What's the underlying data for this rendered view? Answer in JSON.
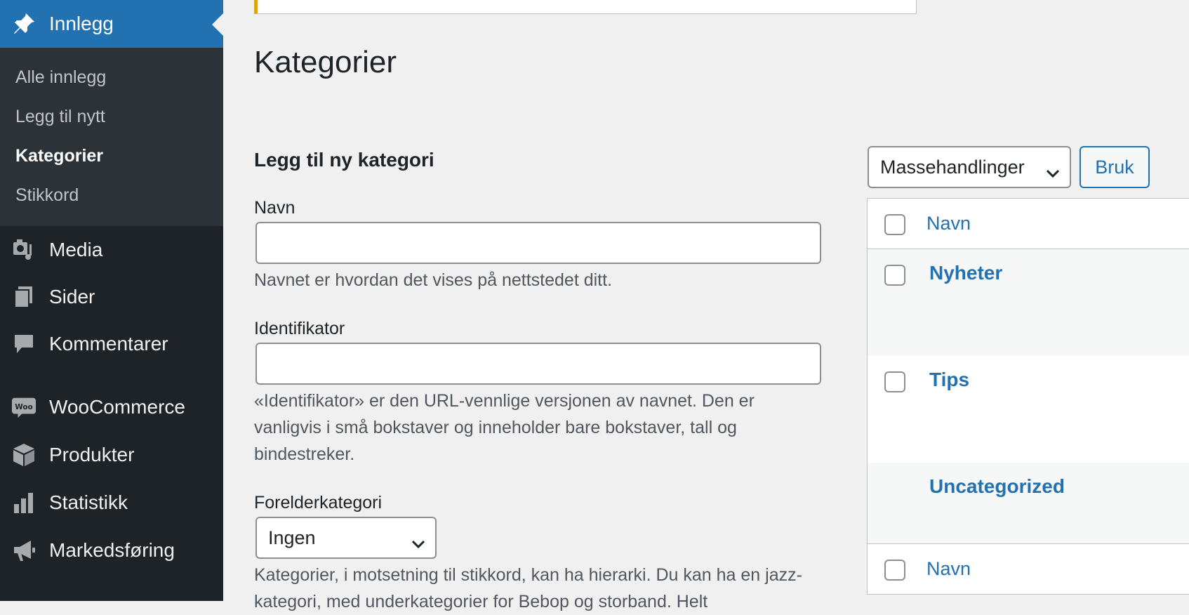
{
  "sidebar": {
    "active_menu": {
      "label": "Innlegg",
      "icon": "pin-icon"
    },
    "submenu": [
      {
        "label": "Alle innlegg",
        "current": false
      },
      {
        "label": "Legg til nytt",
        "current": false
      },
      {
        "label": "Kategorier",
        "current": true
      },
      {
        "label": "Stikkord",
        "current": false
      }
    ],
    "menu": [
      {
        "label": "Media",
        "icon": "media-icon"
      },
      {
        "label": "Sider",
        "icon": "pages-icon"
      },
      {
        "label": "Kommentarer",
        "icon": "comment-icon"
      },
      {
        "label": "WooCommerce",
        "icon": "woocommerce-icon",
        "icon_text": "Woo"
      },
      {
        "label": "Produkter",
        "icon": "box-icon"
      },
      {
        "label": "Statistikk",
        "icon": "bar-chart-icon"
      },
      {
        "label": "Markedsføring",
        "icon": "megaphone-icon"
      }
    ],
    "colors": {
      "background": "#1d2327",
      "submenu_bg": "#2c3338",
      "active": "#2271b1"
    }
  },
  "main": {
    "title": "Kategorier",
    "form": {
      "heading": "Legg til ny kategori",
      "name_label": "Navn",
      "name_value": "",
      "name_help": "Navnet er hvordan det vises på nettstedet ditt.",
      "slug_label": "Identifikator",
      "slug_value": "",
      "slug_help": "«Identifikator» er den URL-vennlige versjonen av navnet. Den er vanligvis i små bokstaver og inneholder bare bokstaver, tall og bindestreker.",
      "parent_label": "Forelderkategori",
      "parent_value": "Ingen",
      "parent_help": "Kategorier, i motsetning til stikkord, kan ha hierarki. Du kan ha en jazz-kategori, med underkategorier for Bebop og storband. Helt"
    },
    "list": {
      "bulk_actions": "Massehandlinger",
      "apply_label": "Bruk",
      "column_header": "Navn",
      "column_footer": "Navn",
      "rows": [
        {
          "name": "Nyheter",
          "has_checkbox": true
        },
        {
          "name": "Tips",
          "has_checkbox": true
        },
        {
          "name": "Uncategorized",
          "has_checkbox": false
        }
      ]
    },
    "colors": {
      "link": "#2271b1",
      "notice_border": "#dba617"
    }
  }
}
